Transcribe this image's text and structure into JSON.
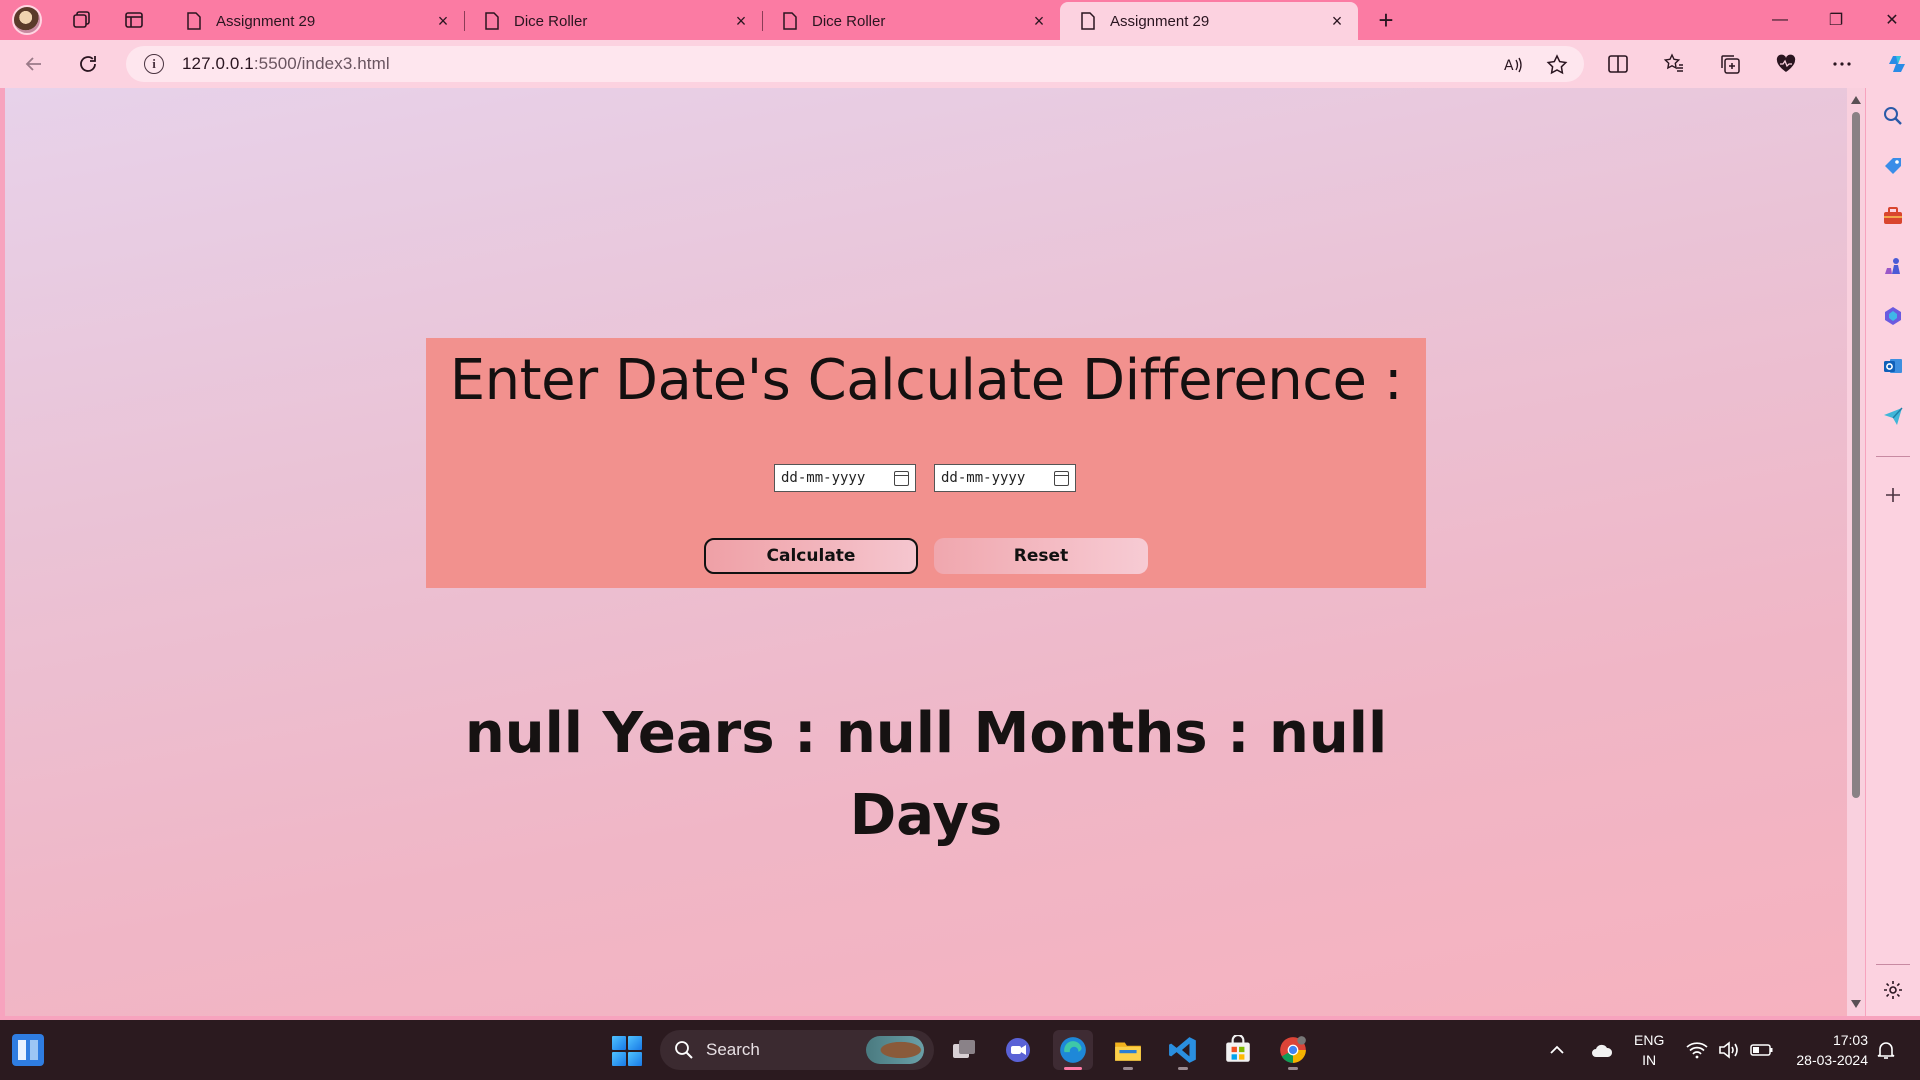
{
  "browser": {
    "tabs": [
      {
        "title": "Assignment 29",
        "active": false
      },
      {
        "title": "Dice Roller",
        "active": false
      },
      {
        "title": "Dice Roller",
        "active": false
      },
      {
        "title": "Assignment 29",
        "active": true
      }
    ],
    "url_host": "127.0.0.1",
    "url_rest": ":5500/index3.html"
  },
  "page": {
    "heading": "Enter Date's Calculate Difference :",
    "date1_placeholder": "dd-mm-yyyy",
    "date2_placeholder": "dd-mm-yyyy",
    "calculate_label": "Calculate",
    "reset_label": "Reset",
    "result_line1": "null Years : null Months : null",
    "result_line2": "Days"
  },
  "taskbar": {
    "search_label": "Search",
    "lang_line1": "ENG",
    "lang_line2": "IN",
    "time": "17:03",
    "date": "28-03-2024"
  },
  "colors": {
    "tab_strip": "#fb7ba3",
    "card": "#f2918e",
    "taskbar": "#2b1a1f"
  }
}
